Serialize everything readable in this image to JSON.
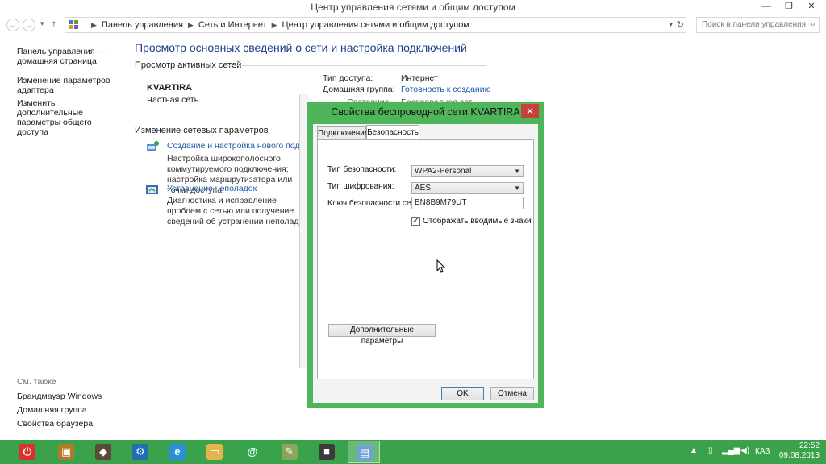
{
  "window": {
    "title": "Центр управления сетями и общим доступом",
    "min_glyph": "—",
    "restore_glyph": "❐",
    "close_glyph": "✕"
  },
  "address_bar": {
    "crumbs": [
      "Панель управления",
      "Сеть и Интернет",
      "Центр управления сетями и общим доступом"
    ],
    "search_placeholder": "Поиск в панели управления"
  },
  "left_pane": {
    "links": [
      {
        "label": "Панель управления — домашняя страница"
      },
      {
        "label": "Изменение параметров адаптера"
      },
      {
        "label": "Изменить дополнительные параметры общего доступа"
      }
    ],
    "see_also_label": "См. также",
    "see_also": [
      {
        "label": "Брандмауэр Windows"
      },
      {
        "label": "Домашняя группа"
      },
      {
        "label": "Свойства браузера"
      }
    ]
  },
  "main": {
    "heading": "Просмотр основных сведений о сети и настройка подключений",
    "active_networks_label": "Просмотр активных сетей",
    "network": {
      "name": "KVARTIRA",
      "type": "Частная сеть",
      "access_type_label": "Тип доступа:",
      "access_type_value": "Интернет",
      "homegroup_label": "Домашняя группа:",
      "homegroup_value": "Готовность к созданию",
      "connection_label": "Состояние:",
      "connection_value": "Беспроводная сеть"
    },
    "change_settings_label": "Изменение сетевых параметров",
    "tasks": [
      {
        "title": "Создание и настройка нового подключения",
        "desc": "Настройка широкополосного, коммутируемого подключения; настройка маршрутизатора или точки доступа."
      },
      {
        "title": "Устранение неполадок",
        "desc": "Диагностика и исправление проблем с сетью или получение сведений об устранении неполадок."
      }
    ]
  },
  "dialog": {
    "title": "Свойства беспроводной сети KVARTIRA",
    "close_glyph": "✕",
    "tabs": [
      {
        "label": "Подключение"
      },
      {
        "label": "Безопасность"
      }
    ],
    "security_type_label": "Тип безопасности:",
    "security_type_value": "WPA2-Personal",
    "encryption_label": "Тип шифрования:",
    "encryption_value": "AES",
    "key_label": "Ключ безопасности сети",
    "key_value": "BN8B9M79UT",
    "show_chars_label": "Отображать вводимые знаки",
    "show_chars_checked": true,
    "advanced_button": "Дополнительные параметры",
    "ok_button": "OK",
    "cancel_button": "Отмена"
  },
  "taskbar": {
    "language": "КАЗ",
    "time": "22:52",
    "date": "09.08.2013",
    "apps": [
      {
        "icon": "power-icon",
        "color": "#d9322b"
      },
      {
        "icon": "media-icon",
        "color": "#b07a2a"
      },
      {
        "icon": "game-icon",
        "color": "#5b4a3a"
      },
      {
        "icon": "settings-icon",
        "color": "#1f6fb2"
      },
      {
        "icon": "ie-icon",
        "color": "#2a8ed8"
      },
      {
        "icon": "folder-icon",
        "color": "#e3b54a"
      },
      {
        "icon": "mail-icon",
        "color": "#2fa84f"
      },
      {
        "icon": "notes-icon",
        "color": "#8aa65a"
      },
      {
        "icon": "camera-icon",
        "color": "#3b3b3b"
      },
      {
        "icon": "network-icon",
        "color": "#6fa3d8"
      }
    ]
  },
  "colors": {
    "accent_green": "#3aa24a",
    "dialog_frame": "#4fb55a",
    "link_blue": "#1e5aa8",
    "heading_blue": "#1e3d8f",
    "close_red": "#c7403a"
  }
}
